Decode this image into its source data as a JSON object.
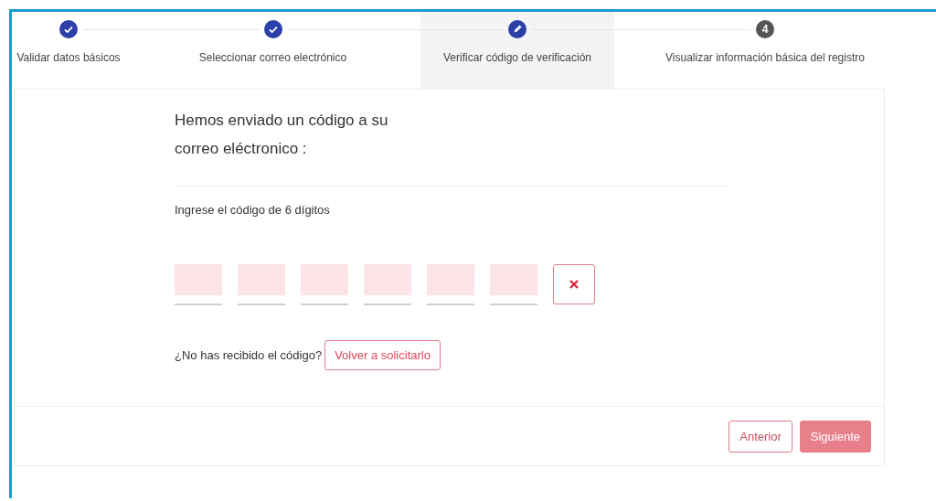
{
  "steps": [
    {
      "label": "Validar datos básicos",
      "kind": "done"
    },
    {
      "label": "Seleccionar correo electrónico",
      "kind": "done"
    },
    {
      "label": "Verificar código de verificación",
      "kind": "current"
    },
    {
      "label": "Visualizar información básica del registro",
      "kind": "pending",
      "number": "4"
    }
  ],
  "heading": "Hemos enviado un código a su correo eléctronico :",
  "code_prompt": "Ingrese el código de 6 dígitos",
  "code_boxes": [
    {
      "filled": false
    },
    {
      "filled": false
    },
    {
      "filled": false
    },
    {
      "filled": false
    },
    {
      "filled": false
    },
    {
      "filled": false
    }
  ],
  "resend": {
    "question": "¿No has recibido el código?",
    "button": "Volver a solicitarlo"
  },
  "buttons": [
    {
      "label": "Anterior",
      "kind": "outline"
    },
    {
      "label": "Siguiente",
      "kind": "primary",
      "disabled": true
    }
  ]
}
